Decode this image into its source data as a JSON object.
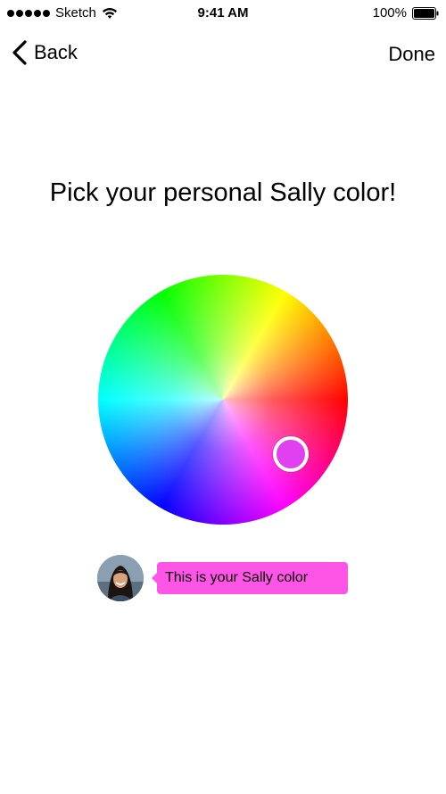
{
  "status_bar": {
    "carrier": "Sketch",
    "time": "9:41 AM",
    "battery": "100%",
    "signal_icon": "signal-dots-icon",
    "wifi_icon": "wifi-icon",
    "battery_icon": "battery-icon"
  },
  "nav": {
    "back_label": "Back",
    "done_label": "Done",
    "back_icon": "chevron-left-icon"
  },
  "title": "Pick your personal Sally color!",
  "tooltip": {
    "text": "This is your Sally color",
    "color": "#ff55e6"
  },
  "selected_color": "#e040f0"
}
